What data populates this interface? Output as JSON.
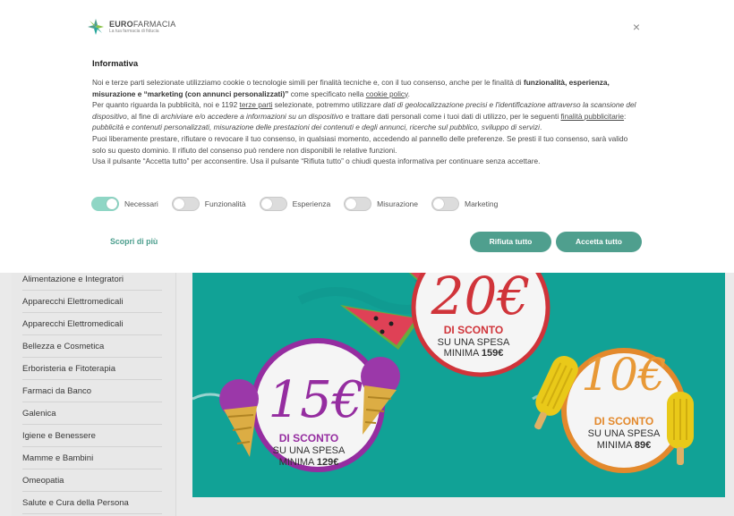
{
  "logo": {
    "brand_bold": "EURO",
    "brand_light": "FARMACIA",
    "tagline": "La tua farmacia di fiducia",
    "colors": [
      "#4f9f8e",
      "#8bc34a",
      "#26a69a"
    ]
  },
  "dialog": {
    "close_label": "×",
    "title": "Informativa",
    "p1": {
      "a": "Noi e terze parti selezionate utilizziamo cookie o tecnologie simili per finalità tecniche e, con il tuo consenso, anche per le finalità di ",
      "b": "funzionalità, esperienza, misurazione e “marketing (con annunci personalizzati)”",
      "c": " come specificato nella ",
      "link": "cookie policy",
      "d": "."
    },
    "p2": {
      "a": "Per quanto riguarda la pubblicità, noi e 1192 ",
      "link1": "terze parti",
      "b": " selezionate, potremmo utilizzare ",
      "i1": "dati di geolocalizzazione precisi e l'identificazione attraverso la scansione del dispositivo",
      "c": ", al fine di ",
      "i2": "archiviare e/o accedere a informazioni su un dispositivo",
      "d": " e trattare dati personali come i tuoi dati di utilizzo, per le seguenti ",
      "link2": "finalità pubblicitarie",
      "e": ": ",
      "i3": "pubblicità e contenuti personalizzati, misurazione delle prestazioni dei contenuti e degli annunci, ricerche sul pubblico, sviluppo di servizi",
      "f": "."
    },
    "p3": "Puoi liberamente prestare, rifiutare o revocare il tuo consenso, in qualsiasi momento, accedendo al pannello delle preferenze. Se presti il tuo consenso, sarà valido solo su questo dominio. Il rifiuto del consenso può rendere non disponibili le relative funzioni.",
    "p4": "Usa il pulsante “Accetta tutto” per acconsentire. Usa il pulsante “Rifiuta tutto” o chiudi questa informativa per continuare senza accettare.",
    "toggles": [
      {
        "label": "Necessari",
        "on": true
      },
      {
        "label": "Funzionalità",
        "on": false
      },
      {
        "label": "Esperienza",
        "on": false
      },
      {
        "label": "Misurazione",
        "on": false
      },
      {
        "label": "Marketing",
        "on": false
      }
    ],
    "learn_more": "Scopri di più",
    "reject_all": "Rifiuta tutto",
    "accept_all": "Accetta tutto",
    "accent_color": "#4f9f8e"
  },
  "sidebar": {
    "items": [
      "Alimentazione e Integratori",
      "Apparecchi Elettromedicali",
      "Apparecchi Elettromedicali",
      "Bellezza e Cosmetica",
      "Erboristeria e Fitoterapia",
      "Farmaci da Banco",
      "Galenica",
      "Igiene e Benessere",
      "Mamme e Bambini",
      "Omeopatia",
      "Salute e Cura della Persona"
    ]
  },
  "banner": {
    "background_color": "#12a99d",
    "offer_20": {
      "amount": "20€",
      "line1": "DI SCONTO",
      "line2": "SU UNA SPESA",
      "line3_a": "MINIMA ",
      "line3_b": "159€"
    },
    "offer_15": {
      "amount": "15€",
      "line1": "DI SCONTO",
      "line2": "SU UNA SPESA",
      "line3_a": "MINIMA ",
      "line3_b": "129€"
    },
    "offer_10": {
      "amount": "10€",
      "line1": "DI SCONTO",
      "line2": "SU UNA SPESA",
      "line3_a": "MINIMA ",
      "line3_b": "89€"
    }
  }
}
